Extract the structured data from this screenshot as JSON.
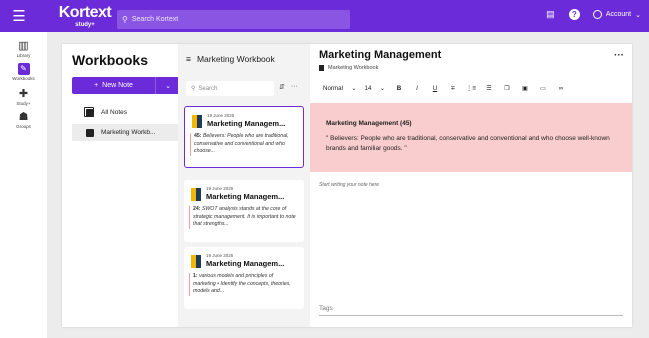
{
  "topbar": {
    "logo_main": "Kortext",
    "logo_sub": "study+",
    "search_placeholder": "Search Kortext",
    "account_label": "Account"
  },
  "rail": {
    "items": [
      {
        "label": "Library",
        "icon": "library-icon"
      },
      {
        "label": "Workbooks",
        "icon": "workbook-icon"
      },
      {
        "label": "Study+",
        "icon": "plus-icon"
      },
      {
        "label": "Groups",
        "icon": "groups-icon"
      }
    ]
  },
  "workbooks": {
    "title": "Workbooks",
    "new_note_label": "New Note",
    "nav": [
      {
        "label": "All Notes"
      },
      {
        "label": "Marketing Workb..."
      }
    ]
  },
  "notes": {
    "header": "Marketing Workbook",
    "search_placeholder": "Search",
    "items": [
      {
        "date": "19 June 2025",
        "title": "Marketing Managem...",
        "number": "45:",
        "snippet": "Believers: People who are traditional, conservative and conventional and who choose..."
      },
      {
        "date": "19 June 2025",
        "title": "Marketing Managem...",
        "number": "24:",
        "snippet": "SWOT analysis stands at the core of strategic management. It is important to note that strengths..."
      },
      {
        "date": "19 June 2025",
        "title": "Marketing Managem...",
        "number": "1:",
        "snippet": "various models and principles of marketing • Identify the concepts, theories, models and..."
      }
    ]
  },
  "editor": {
    "title": "Marketing Management",
    "workbook": "Marketing Workbook",
    "style_select": "Normal",
    "size_select": "14",
    "highlight_heading": "Marketing Management (45)",
    "highlight_text": "\" Believers: People who are traditional, conservative and conventional and who choose well-known brands and familiar goods. \"",
    "placeholder": "Start writing your note here",
    "tags_placeholder": "Tags"
  },
  "colors": {
    "brand": "#6c2bd9",
    "highlight": "#f9cdcd"
  }
}
